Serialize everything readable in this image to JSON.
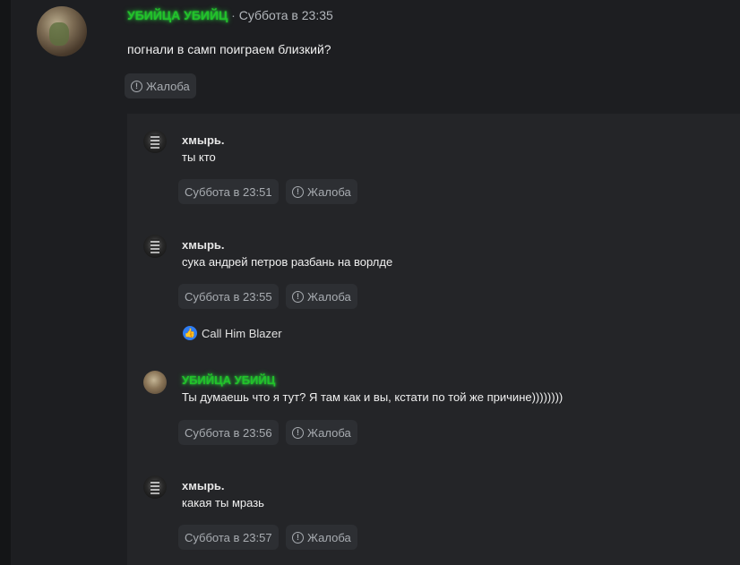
{
  "post": {
    "author": "УБИЙЦА УБИЙЦ",
    "separator": "·",
    "date": "Суббота в 23:35",
    "text": "погнали в самп поиграем близкий?",
    "report_label": "Жалоба"
  },
  "comments": [
    {
      "author": "хмырь.",
      "text": "ты кто",
      "date": "Суббота в 23:51",
      "report_label": "Жалоба"
    },
    {
      "author": "хмырь.",
      "text": "сука андрей петров разбань на ворлде",
      "date": "Суббота в 23:55",
      "report_label": "Жалоба",
      "liked_by": "Call Him Blazer"
    },
    {
      "author": "УБИЙЦА УБИЙЦ",
      "text": "Ты думаешь что я тут? Я там как и вы, кстати по той же причине))))))))",
      "date": "Суббота в 23:56",
      "report_label": "Жалоба"
    },
    {
      "author": "хмырь.",
      "text": "какая ты мразь",
      "date": "Суббота в 23:57",
      "report_label": "Жалоба"
    }
  ],
  "icons": {
    "report": "alert-circle-icon",
    "like": "thumbs-up-icon"
  },
  "colors": {
    "highlight_name": "#22c22a",
    "like": "#2f7df2",
    "background": "#1d1e21",
    "comments_background": "#242528"
  }
}
